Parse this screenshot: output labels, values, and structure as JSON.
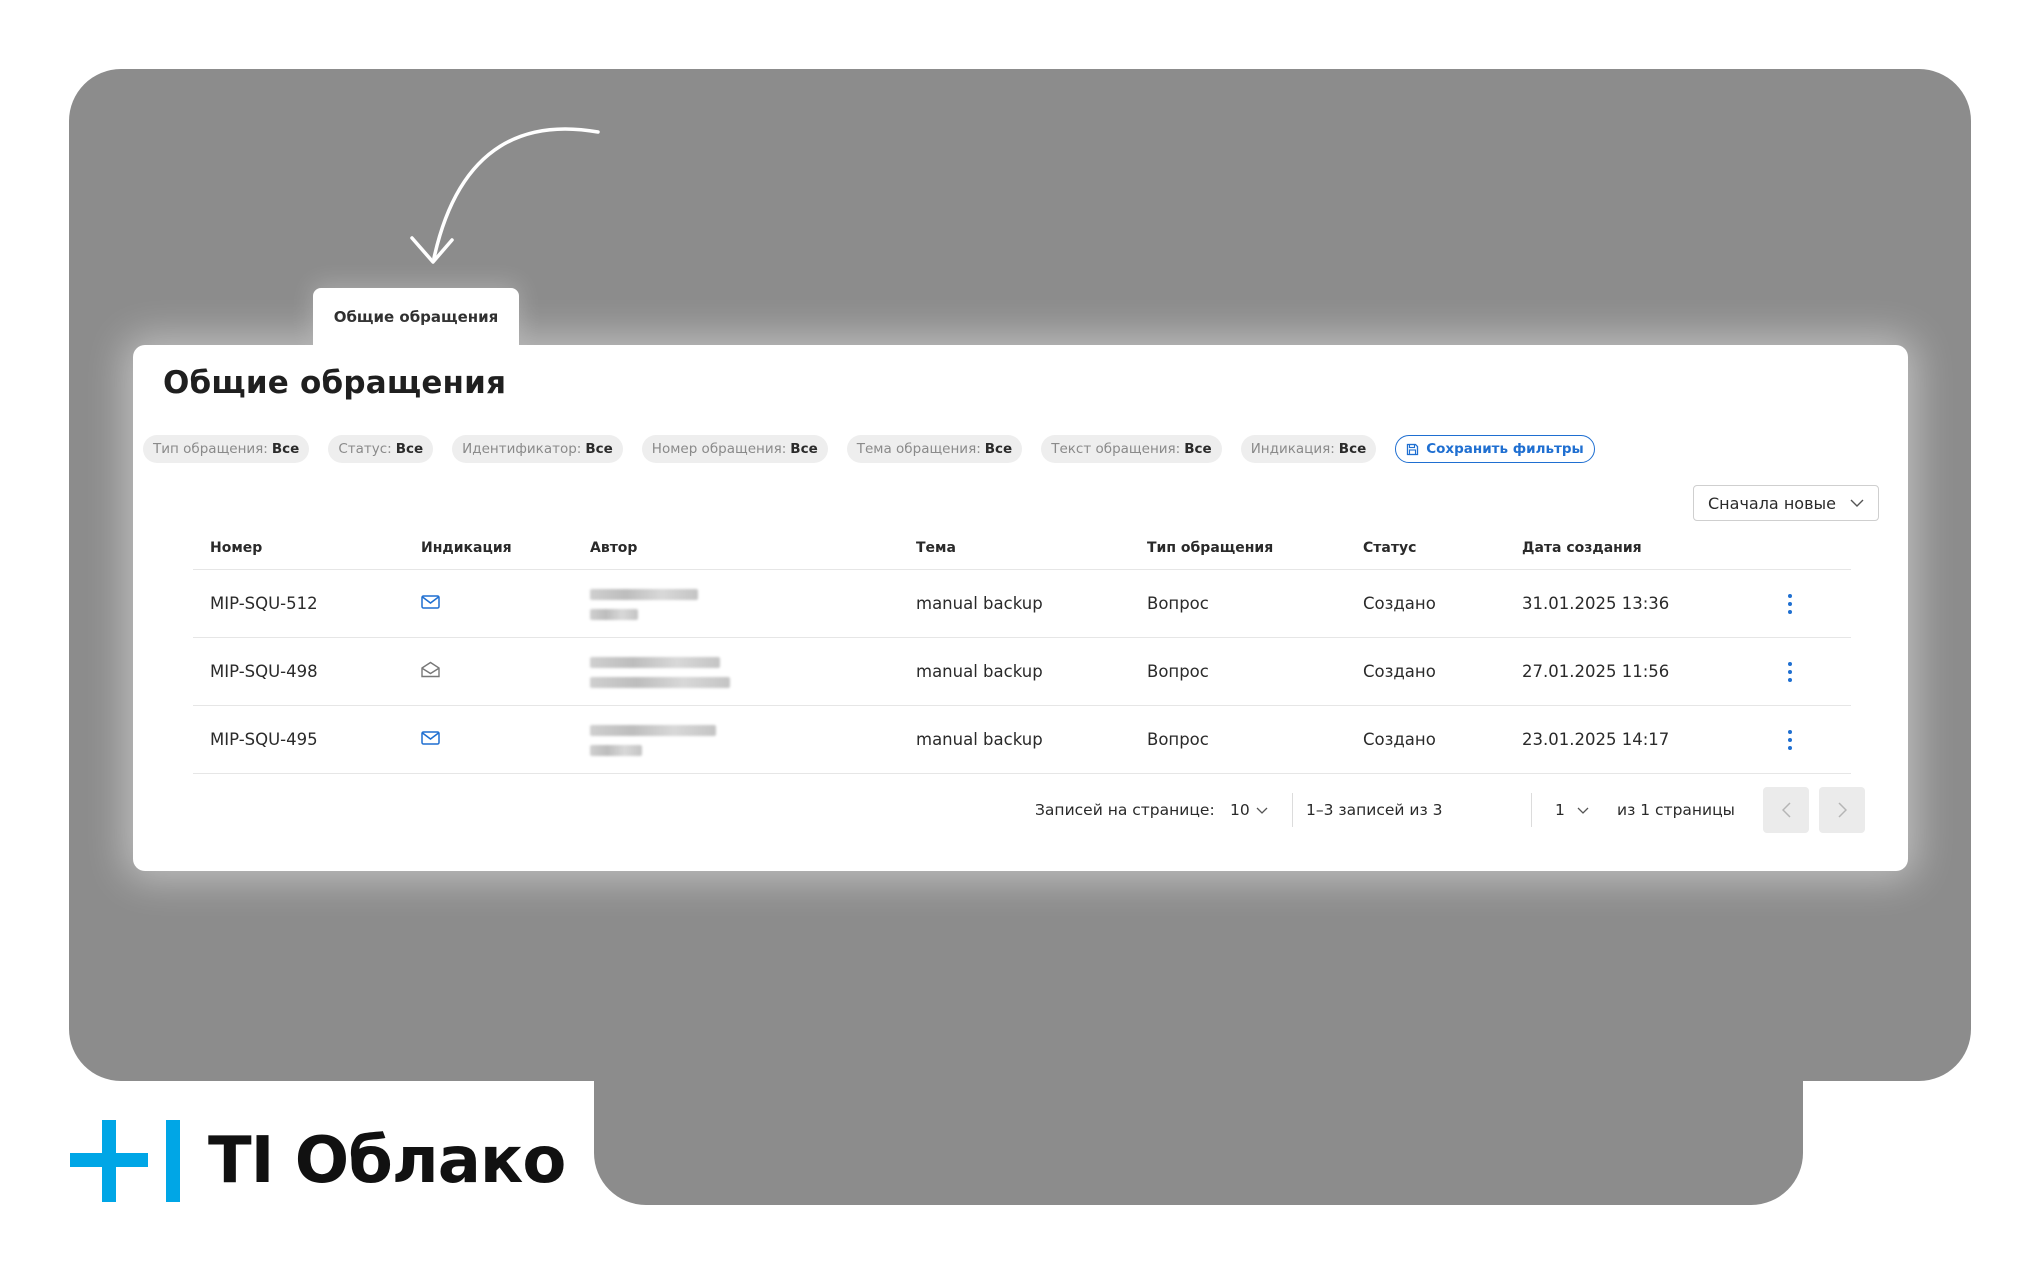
{
  "tab": {
    "label": "Общие обращения"
  },
  "page_title": "Общие обращения",
  "filters": [
    {
      "label": "Тип обращения:",
      "value": "Все"
    },
    {
      "label": "Статус:",
      "value": "Все"
    },
    {
      "label": "Идентификатор:",
      "value": "Все"
    },
    {
      "label": "Номер обращения:",
      "value": "Все"
    },
    {
      "label": "Тема обращения:",
      "value": "Все"
    },
    {
      "label": "Текст обращения:",
      "value": "Все"
    },
    {
      "label": "Индикация:",
      "value": "Все"
    }
  ],
  "save_filters_label": "Сохранить фильтры",
  "sort": {
    "selected": "Сначала новые"
  },
  "table": {
    "headers": [
      "Номер",
      "Индикация",
      "Автор",
      "Тема",
      "Тип обращения",
      "Статус",
      "Дата создания"
    ],
    "rows": [
      {
        "number": "MIP-SQU-512",
        "indication": "envelope-closed-icon",
        "topic": "manual backup",
        "type": "Вопрос",
        "status": "Создано",
        "date": "31.01.2025 13:36"
      },
      {
        "number": "MIP-SQU-498",
        "indication": "envelope-open-icon",
        "topic": "manual backup",
        "type": "Вопрос",
        "status": "Создано",
        "date": "27.01.2025 11:56"
      },
      {
        "number": "MIP-SQU-495",
        "indication": "envelope-closed-icon",
        "topic": "manual backup",
        "type": "Вопрос",
        "status": "Создано",
        "date": "23.01.2025 14:17"
      }
    ]
  },
  "pagination": {
    "per_page_label": "Записей на странице:",
    "per_page_value": "10",
    "range_label": "1–3 записей из 3",
    "page_value": "1",
    "of_pages_label": "из 1 страницы"
  },
  "logo": {
    "text": "TI Облако"
  },
  "colors": {
    "accent": "#1f6fd1",
    "brand_cyan": "#00a6e6",
    "backdrop": "#8c8c8c"
  }
}
